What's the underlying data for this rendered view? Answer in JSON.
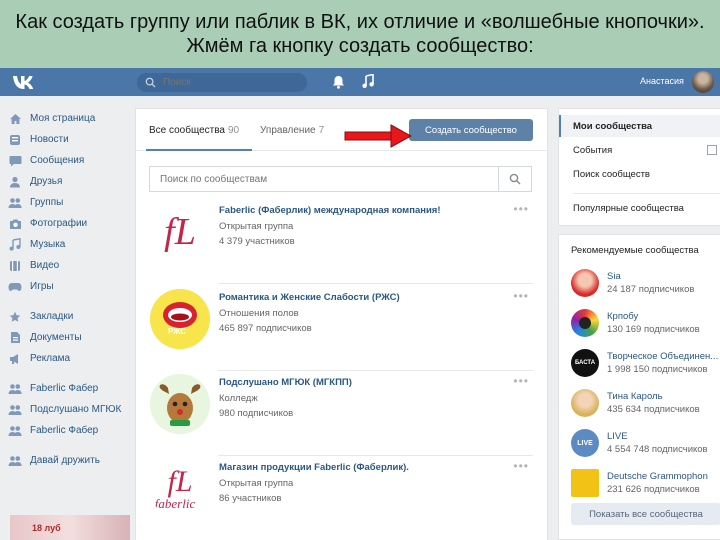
{
  "banner": {
    "title": "Как создать группу или паблик в ВК, их отличие и «волшебные кнопочки». Жмём га кнопку создать сообщество:"
  },
  "header": {
    "logo_icon": "vk-logo-icon",
    "search_placeholder": "Поиск",
    "user_name": "Анастасия"
  },
  "left_menu": {
    "items": [
      {
        "label": "Моя страница",
        "icon": "home-icon"
      },
      {
        "label": "Новости",
        "icon": "news-icon"
      },
      {
        "label": "Сообщения",
        "icon": "messages-icon"
      },
      {
        "label": "Друзья",
        "icon": "friends-icon"
      },
      {
        "label": "Группы",
        "icon": "groups-icon"
      },
      {
        "label": "Фотографии",
        "icon": "camera-icon"
      },
      {
        "label": "Музыка",
        "icon": "music-icon"
      },
      {
        "label": "Видео",
        "icon": "video-icon"
      },
      {
        "label": "Игры",
        "icon": "games-icon"
      }
    ],
    "items2": [
      {
        "label": "Закладки",
        "icon": "star-icon"
      },
      {
        "label": "Документы",
        "icon": "document-icon"
      },
      {
        "label": "Реклама",
        "icon": "ads-icon"
      }
    ],
    "items3": [
      {
        "label": "Faberlic Фабер",
        "icon": "community-icon"
      },
      {
        "label": "Подслушано МГЮК",
        "icon": "community-icon"
      },
      {
        "label": "Faberlic Фабер",
        "icon": "community-icon"
      }
    ],
    "items4": [
      {
        "label": "Давай дружить",
        "icon": "community-icon"
      }
    ],
    "ad_text": "18 луб"
  },
  "main": {
    "tab_all_label": "Все сообщества",
    "tab_all_count": "90",
    "tab_manage_label": "Управление",
    "tab_manage_count": "7",
    "create_button": "Создать сообщество",
    "search_placeholder": "Поиск по сообществам",
    "groups": [
      {
        "name": "Faberlic (Фаберлик) международная компания!",
        "type": "Открытая группа",
        "count": "4 379 участников"
      },
      {
        "name": "Романтика и Женские Слабости (РЖС)",
        "type": "Отношения полов",
        "count": "465 897 подписчиков",
        "avatar_text": "РЖС"
      },
      {
        "name": "Подслушано МГЮК (МГКПП)",
        "type": "Колледж",
        "count": "980 подписчиков"
      },
      {
        "name": "Магазин продукции Faberlic (Фаберлик).",
        "type": "Открытая группа",
        "count": "86 участников"
      }
    ],
    "logo_text_1": "fL",
    "logo_text_2_top": "fL",
    "logo_text_2_bottom": "faberlic"
  },
  "right_top": {
    "active": "Мои сообщества",
    "items": [
      "События",
      "Поиск сообществ",
      "Популярные сообщества"
    ]
  },
  "recommended": {
    "title": "Рекомендуемые сообщества",
    "items": [
      {
        "name": "Sia",
        "subs": "24 187 подписчиков"
      },
      {
        "name": "Крпобу",
        "subs": "130 169 подписчиков"
      },
      {
        "name": "Творческое Объединен...",
        "subs": "1 998 150 подписчиков",
        "avatar_text": "БАСТА"
      },
      {
        "name": "Тина Кароль",
        "subs": "435 634 подписчиков"
      },
      {
        "name": "LIVE",
        "subs": "4 554 748 подписчиков",
        "avatar_text": "LIVE"
      },
      {
        "name": "Deutsche Grammophon",
        "subs": "231 626 подписчиков"
      }
    ],
    "show_all": "Показать все сообщества"
  },
  "colors": {
    "header": "#4a76a8",
    "link": "#2a5885",
    "create_button": "#5e81a8",
    "arrow": "#e8171c",
    "banner": "#a9cdb5"
  }
}
